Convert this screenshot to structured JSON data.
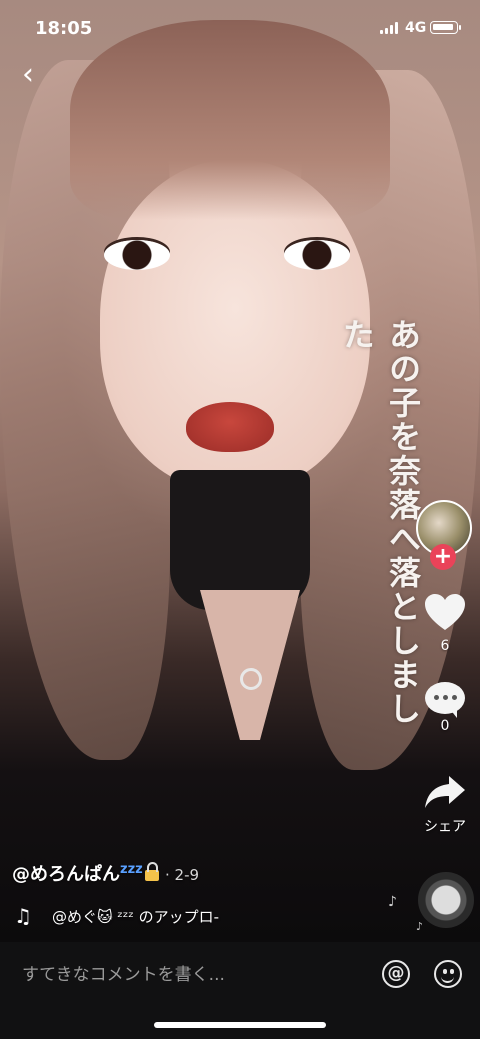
{
  "status_bar": {
    "time": "18:05",
    "network": "4G"
  },
  "overlay_text": "あの子を奈落へ落としました",
  "actions": {
    "likes": "6",
    "comments": "0",
    "share_label": "シェア"
  },
  "post": {
    "username": "@めろんぱん",
    "zzz": "zzz",
    "date": "· 2-9",
    "music": "@めぐ🐱 ᶻᶻᶻ のアップロ-"
  },
  "comment_bar": {
    "placeholder": "すてきなコメントを書く..."
  },
  "icons": {
    "back": "chevron-left-icon",
    "like": "heart-icon",
    "comment": "comment-icon",
    "share": "share-arrow-icon",
    "music": "music-note-icon",
    "mention": "at-sign-icon",
    "emoji": "smiley-icon"
  },
  "colors": {
    "follow_badge": "#ea4359",
    "zzz": "#5aa0ff"
  }
}
